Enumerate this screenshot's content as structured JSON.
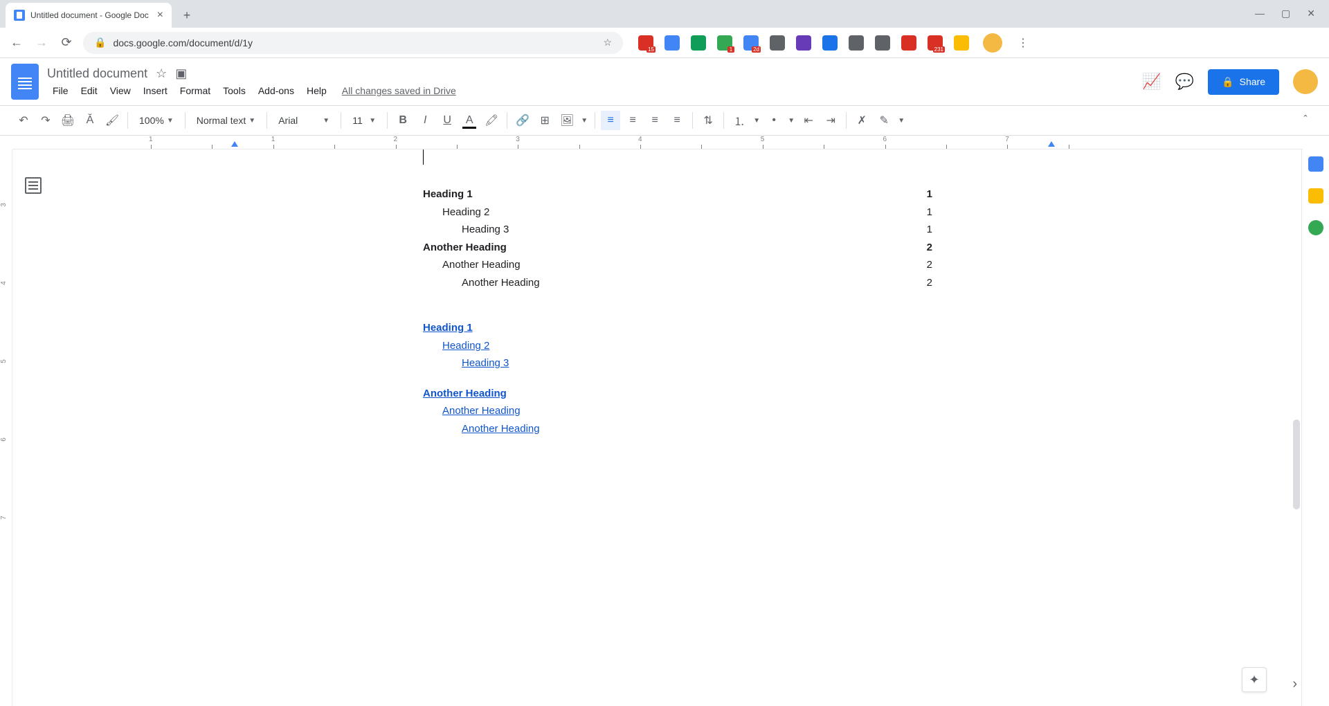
{
  "browser": {
    "tab_title": "Untitled document - Google Doc",
    "url": "docs.google.com/document/d/1y",
    "extensions": [
      {
        "color": "#d93025",
        "badge": "15"
      },
      {
        "color": "#4285f4",
        "badge": ""
      },
      {
        "color": "#0f9d58",
        "badge": ""
      },
      {
        "color": "#34a853",
        "badge": "1"
      },
      {
        "color": "#4285f4",
        "badge": "2d"
      },
      {
        "color": "#5f6368",
        "badge": ""
      },
      {
        "color": "#673ab7",
        "badge": ""
      },
      {
        "color": "#1a73e8",
        "badge": ""
      },
      {
        "color": "#5f6368",
        "badge": ""
      },
      {
        "color": "#5f6368",
        "badge": ""
      },
      {
        "color": "#d93025",
        "badge": ""
      },
      {
        "color": "#d93025",
        "badge": "231"
      },
      {
        "color": "#fbbc04",
        "badge": ""
      }
    ]
  },
  "header": {
    "doc_title": "Untitled document",
    "menu": [
      "File",
      "Edit",
      "View",
      "Insert",
      "Format",
      "Tools",
      "Add-ons",
      "Help"
    ],
    "save_status": "All changes saved in Drive",
    "share_label": "Share"
  },
  "toolbar": {
    "zoom": "100%",
    "style": "Normal text",
    "font": "Arial",
    "size": "11"
  },
  "ruler": {
    "marks": [
      "1",
      "",
      "1",
      "",
      "2",
      "",
      "3",
      "",
      "4",
      "",
      "5",
      "",
      "6",
      "",
      "7",
      ""
    ],
    "left_marks": [
      "3",
      "4",
      "5",
      "6",
      "7"
    ]
  },
  "document": {
    "toc_numbered": [
      {
        "level": 1,
        "text": "Heading 1",
        "page": "1"
      },
      {
        "level": 2,
        "text": "Heading 2",
        "page": "1"
      },
      {
        "level": 3,
        "text": "Heading 3",
        "page": "1"
      },
      {
        "level": 1,
        "text": "Another Heading",
        "page": "2"
      },
      {
        "level": 2,
        "text": "Another Heading",
        "page": "2"
      },
      {
        "level": 3,
        "text": "Another Heading",
        "page": "2"
      }
    ],
    "toc_links": [
      {
        "level": 1,
        "text": "Heading 1",
        "group_first": true
      },
      {
        "level": 2,
        "text": "Heading 2"
      },
      {
        "level": 3,
        "text": "Heading 3"
      },
      {
        "level": 1,
        "text": "Another Heading",
        "group_first": true
      },
      {
        "level": 2,
        "text": "Another Heading"
      },
      {
        "level": 3,
        "text": "Another Heading"
      }
    ]
  }
}
